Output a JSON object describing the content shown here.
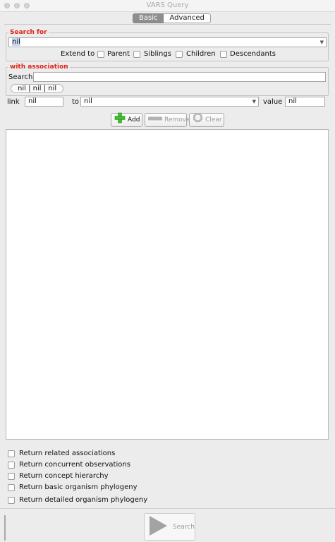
{
  "window": {
    "title": "VARS Query"
  },
  "tabs": {
    "basic": "Basic",
    "advanced": "Advanced",
    "active": "Basic"
  },
  "search_for": {
    "title": "Search for",
    "value": "nil",
    "extend_label": "Extend to",
    "extend_options": [
      {
        "label": "Parent",
        "checked": false
      },
      {
        "label": "Siblings",
        "checked": false
      },
      {
        "label": "Children",
        "checked": false
      },
      {
        "label": "Descendants",
        "checked": false
      }
    ]
  },
  "association": {
    "title": "with association",
    "search_label": "Search:",
    "search_value": "",
    "selected_association": "nil | nil | nil",
    "link_label": "link",
    "link_value": "nil",
    "to_label": "to",
    "to_value": "nil",
    "value_label": "value",
    "value_value": "nil"
  },
  "actions": {
    "add": "Add",
    "remove": "Remove",
    "clear": "Clear"
  },
  "list": {
    "items": []
  },
  "options": [
    {
      "label": "Return related associations",
      "checked": false
    },
    {
      "label": "Return concurrent observations",
      "checked": false
    },
    {
      "label": "Return concept hierarchy",
      "checked": false
    },
    {
      "label": "Return basic organism phylogeny",
      "checked": false
    },
    {
      "label": "Return detailed organism phylogeny",
      "checked": false
    }
  ],
  "search_button": "Search",
  "colors": {
    "accent_red": "#e0211b",
    "add_green": "#3fbf2f",
    "tab_active": "#8e8e8e"
  }
}
